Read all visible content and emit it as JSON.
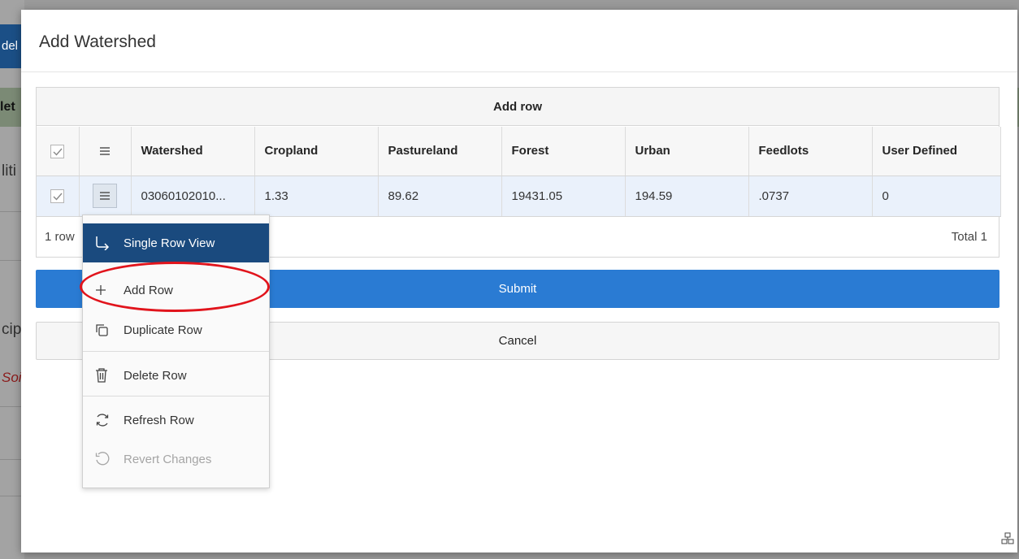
{
  "background": {
    "btn_fragment": "del",
    "hdr_fragment": "let",
    "frag1": "liti",
    "frag2": "cip",
    "frag3": "Soi"
  },
  "dialog": {
    "title": "Add Watershed",
    "add_row_label": "Add row",
    "columns": [
      "Watershed",
      "Cropland",
      "Pastureland",
      "Forest",
      "Urban",
      "Feedlots",
      "User Defined"
    ],
    "rows": [
      [
        "03060102010...",
        "1.33",
        "89.62",
        "19431.05",
        "194.59",
        ".0737",
        "0"
      ]
    ],
    "footer_left": "1 row",
    "footer_right": "Total 1",
    "submit_label": "Submit",
    "cancel_label": "Cancel"
  },
  "context_menu": {
    "items": [
      {
        "label": "Single Row View",
        "icon": "single-row-view-icon"
      },
      {
        "label": "Add Row",
        "icon": "plus-icon"
      },
      {
        "label": "Duplicate Row",
        "icon": "duplicate-icon"
      },
      {
        "label": "Delete Row",
        "icon": "trash-icon"
      },
      {
        "label": "Refresh Row",
        "icon": "refresh-icon"
      },
      {
        "label": "Revert Changes",
        "icon": "revert-icon"
      }
    ]
  },
  "colors": {
    "submit": "#2a7bd3",
    "menu_selected": "#1a4a7e",
    "highlight": "#e1141c",
    "selected_row": "#eaf1fb"
  }
}
